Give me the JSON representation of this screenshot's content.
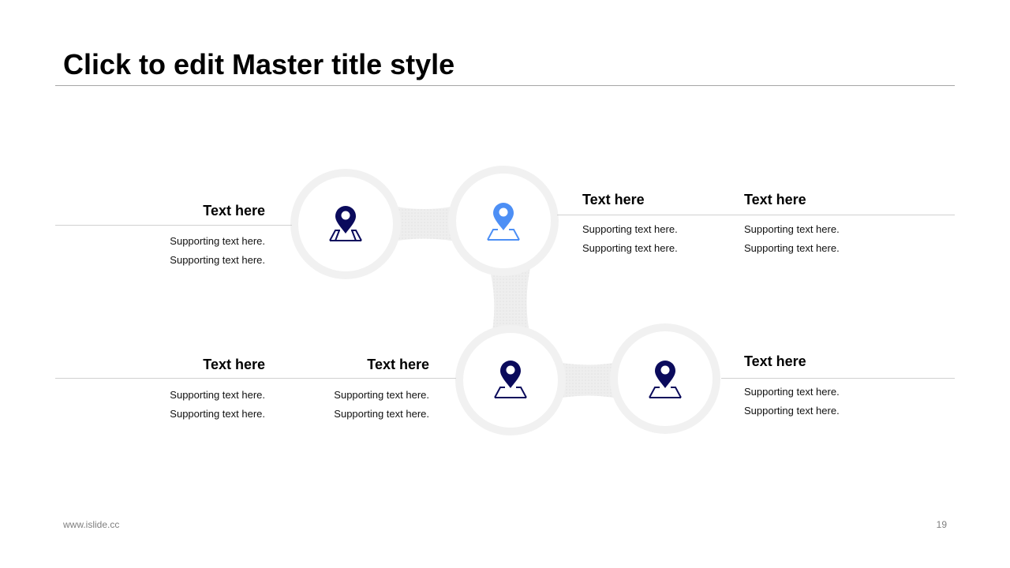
{
  "slide": {
    "title": "Click to edit Master title style",
    "footer_left": "www.islide.cc",
    "page_number": "19"
  },
  "colors": {
    "dark_pin": "#0b0b5c",
    "accent_pin": "#4d8ff5",
    "ring": "#f1f1f1",
    "connector": "#ececec"
  },
  "items": [
    {
      "heading": "Text here",
      "lines": [
        "Supporting  text here.",
        "Supporting  text here."
      ],
      "icon": "map-pin-icon"
    },
    {
      "heading": "Text here",
      "lines": [
        "Supporting  text here.",
        "Supporting  text here."
      ],
      "icon": "map-pin-icon"
    },
    {
      "heading": "Text here",
      "lines": [
        "Supporting  text here.",
        "Supporting  text here."
      ],
      "icon": "map-pin-icon"
    },
    {
      "heading": "Text here",
      "lines": [
        "Supporting  text here.",
        "Supporting  text here."
      ],
      "icon": "map-pin-icon"
    },
    {
      "heading": "Text here",
      "lines": [
        "Supporting  text here.",
        "Supporting  text here."
      ],
      "icon": "map-pin-icon"
    },
    {
      "heading": "Text here",
      "lines": [
        "Supporting  text here.",
        "Supporting  text here."
      ],
      "icon": "map-pin-icon"
    }
  ]
}
